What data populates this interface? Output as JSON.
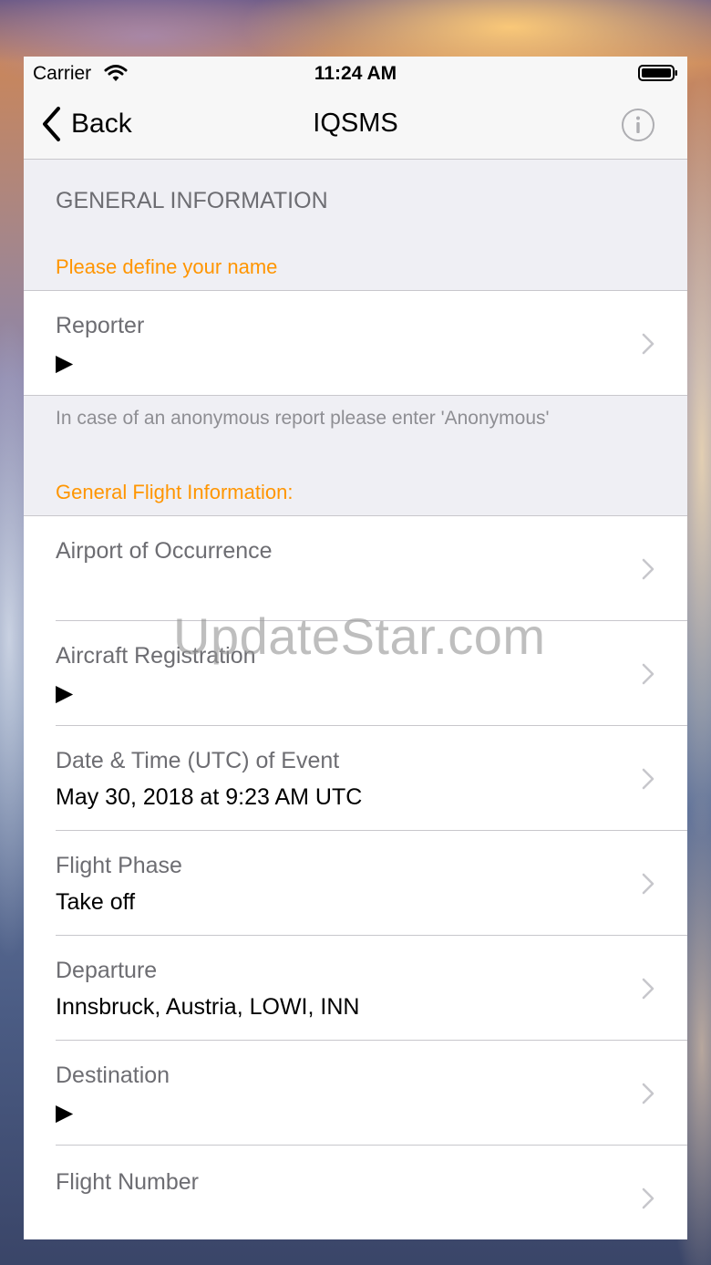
{
  "status_bar": {
    "carrier": "Carrier",
    "time": "11:24 AM"
  },
  "nav": {
    "back_label": "Back",
    "title": "IQSMS",
    "info_icon": "info-circle-icon"
  },
  "general": {
    "header": "GENERAL INFORMATION",
    "subheader": "Please define your name",
    "reporter": {
      "label": "Reporter",
      "value": "▶"
    },
    "footer": "In case of an anonymous report please enter 'Anonymous'"
  },
  "flight": {
    "header": "General Flight Information:",
    "rows": [
      {
        "label": "Airport of Occurrence",
        "value": ""
      },
      {
        "label": "Aircraft Registration",
        "value": "▶"
      },
      {
        "label": "Date & Time (UTC) of Event",
        "value": "May 30, 2018 at 9:23 AM UTC"
      },
      {
        "label": "Flight Phase",
        "value": "Take off"
      },
      {
        "label": "Departure",
        "value": "Innsbruck, Austria, LOWI, INN"
      },
      {
        "label": "Destination",
        "value": "▶"
      },
      {
        "label": "Flight Number",
        "value": ""
      }
    ]
  },
  "watermark": "UpdateStar.com",
  "colors": {
    "accent_orange": "#ff9500",
    "section_gray": "#6d6d72",
    "chevron_gray": "#c7c7cc"
  }
}
